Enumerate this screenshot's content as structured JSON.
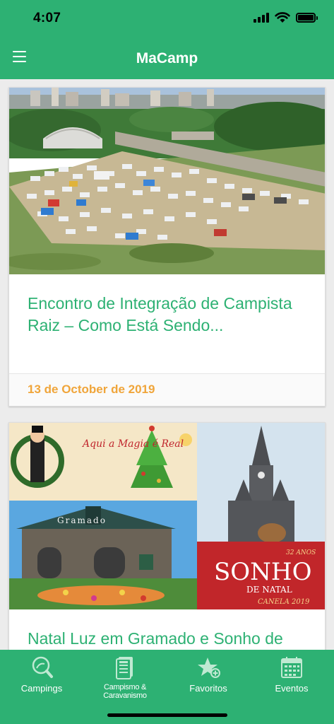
{
  "status_bar": {
    "time": "4:07"
  },
  "header": {
    "title": "MaCamp",
    "menu_icon": "hamburger-menu-icon",
    "color": "#2db173"
  },
  "posts": [
    {
      "title": "Encontro de Integração de Campista Raiz – Como Está Sendo...",
      "date": "13 de October de 2019"
    },
    {
      "title": "Natal Luz em Gramado e Sonho de",
      "image_texts": {
        "magic": "Aqui a Magia é Real",
        "gramado": "Gramado",
        "sonho_years": "32 ANOS",
        "sonho": "SONHO",
        "de_natal": "DE NATAL",
        "canela": "CANELA 2019"
      }
    }
  ],
  "tabs": [
    {
      "label": "Campings",
      "icon": "magnifier-icon"
    },
    {
      "label": "Campismo & Caravanismo",
      "icon": "news-icon"
    },
    {
      "label": "Favoritos",
      "icon": "star-add-icon"
    },
    {
      "label": "Eventos",
      "icon": "calendar-icon"
    }
  ],
  "colors": {
    "accent": "#2db173",
    "date": "#f0a53a"
  }
}
